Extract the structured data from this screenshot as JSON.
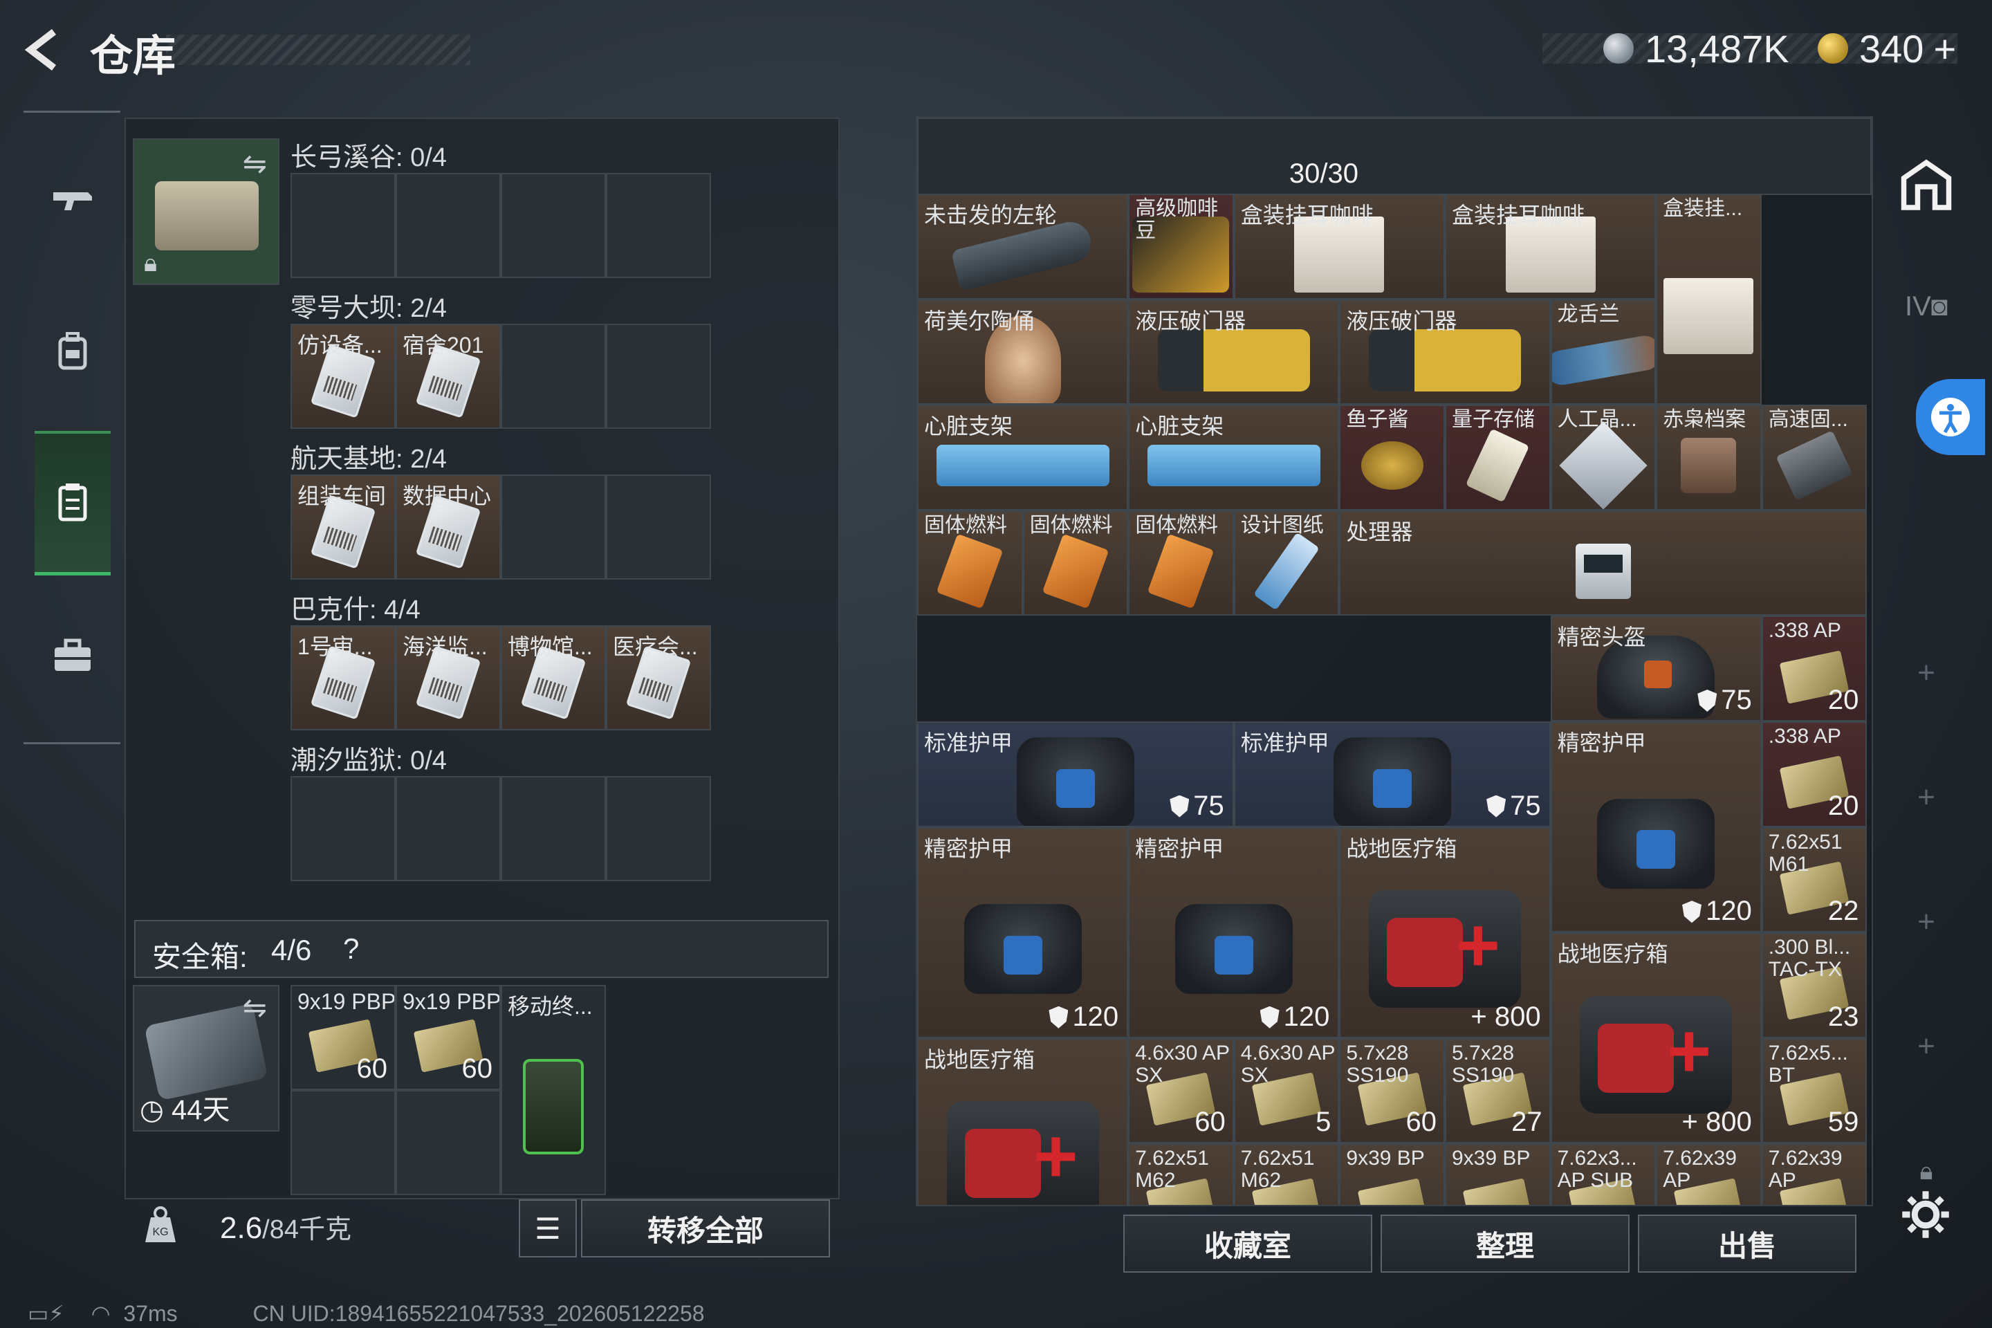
{
  "header": {
    "back_icon": "back-arrow-icon",
    "title": "仓库",
    "money": "13,487K",
    "gold": "340",
    "gold_plus": "+"
  },
  "left_nav": [
    {
      "name": "weapon-icon"
    },
    {
      "name": "backpack-icon"
    },
    {
      "name": "storage-icon",
      "active": true
    },
    {
      "name": "briefcase-icon"
    }
  ],
  "keycard_pouch": {
    "sections": [
      {
        "title": "长弓溪谷: 0/4",
        "cards": []
      },
      {
        "title": "零号大坝: 2/4",
        "cards": [
          "仿设备...",
          "宿舍201"
        ]
      },
      {
        "title": "航天基地: 2/4",
        "cards": [
          "组装车间",
          "数据中心"
        ]
      },
      {
        "title": "巴克什: 4/4",
        "cards": [
          "1号审...",
          "海洋监...",
          "博物馆...",
          "医疗会..."
        ]
      },
      {
        "title": "潮汐监狱: 0/4",
        "cards": []
      }
    ]
  },
  "safebox": {
    "title": "安全箱:",
    "capacity": "4/6",
    "help": "?",
    "days": "44天",
    "items": [
      {
        "label": "9x19 PBP",
        "count": "60"
      },
      {
        "label": "9x19 PBP",
        "count": "60"
      },
      {
        "label": "移动终...",
        "count": ""
      }
    ]
  },
  "footer_left": {
    "weight": "2.6",
    "weight_max": "/84千克",
    "transfer_all": "转移全部"
  },
  "footer_right": {
    "collection": "收藏室",
    "organize": "整理",
    "sell": "出售"
  },
  "grid_top_count": "30/30",
  "grid_items": [
    {
      "label": "未击发的左轮",
      "art": "revolver"
    },
    {
      "label": "高级咖啡豆",
      "art": "coffee-bag"
    },
    {
      "label": "盒装挂耳咖啡",
      "art": "coffee-box"
    },
    {
      "label": "盒装挂耳咖啡",
      "art": "coffee-box"
    },
    {
      "label": "盒装挂...",
      "art": "coffee-box"
    },
    {
      "label": "荷美尔陶俑",
      "art": "doll"
    },
    {
      "label": "液压破门器",
      "art": "breacher"
    },
    {
      "label": "液压破门器",
      "art": "breacher"
    },
    {
      "label": "龙舌兰",
      "art": "orchid"
    },
    {
      "label": "心脏支架",
      "art": "stent"
    },
    {
      "label": "心脏支架",
      "art": "stent"
    },
    {
      "label": "鱼子酱",
      "art": "caviar"
    },
    {
      "label": "量子存储",
      "art": "small-drive"
    },
    {
      "label": "人工晶...",
      "art": "diamond"
    },
    {
      "label": "赤枭档案",
      "art": "archive"
    },
    {
      "label": "高速固...",
      "art": "hdd"
    },
    {
      "label": "固体燃料",
      "art": "fuel"
    },
    {
      "label": "固体燃料",
      "art": "fuel"
    },
    {
      "label": "固体燃料",
      "art": "fuel"
    },
    {
      "label": "设计图纸",
      "art": "blueprint"
    },
    {
      "label": "处理器",
      "art": "server"
    },
    {
      "label": "精密头盔",
      "art": "helmet",
      "value": "75"
    },
    {
      "label": "标准护甲",
      "art": "vest",
      "value": "75"
    },
    {
      "label": "标准护甲",
      "art": "vest",
      "value": "75"
    },
    {
      "label": "精密护甲",
      "art": "vest",
      "value": "120"
    },
    {
      "label": "精密护甲",
      "art": "vest",
      "value": "120"
    },
    {
      "label": "精密护甲",
      "art": "vest",
      "value": "120"
    },
    {
      "label": "战地医疗箱",
      "art": "medkit",
      "value": "800"
    },
    {
      "label": "战地医疗箱",
      "art": "medkit",
      "value": "800"
    },
    {
      "label": "战地医疗箱",
      "art": "medkit"
    },
    {
      "label": ".338 AP",
      "count": "20"
    },
    {
      "label": ".338 AP",
      "count": "20"
    },
    {
      "label": "7.62x51 M61",
      "count": "22"
    },
    {
      "label": ".300 Bl... TAC-TX",
      "count": "23"
    },
    {
      "label": "7.62x5... BT",
      "count": "59"
    },
    {
      "label": "4.6x30 AP SX",
      "count": "60"
    },
    {
      "label": "4.6x30 AP SX",
      "count": "5"
    },
    {
      "label": "5.7x28 SS190",
      "count": "60"
    },
    {
      "label": "5.7x28 SS190",
      "count": "27"
    },
    {
      "label": "7.62x51 M62"
    },
    {
      "label": "7.62x51 M62"
    },
    {
      "label": "9x39 BP"
    },
    {
      "label": "9x39 BP"
    },
    {
      "label": "7.62x3... AP SUB"
    },
    {
      "label": "7.62x39 AP"
    },
    {
      "label": "7.62x39 AP"
    }
  ],
  "status_bar": {
    "ping": "37ms",
    "uid": "CN UID:18941655221047533_202605122258"
  },
  "colors": {
    "accent_green": "#3fb868",
    "access_blue": "#2f86e4"
  }
}
